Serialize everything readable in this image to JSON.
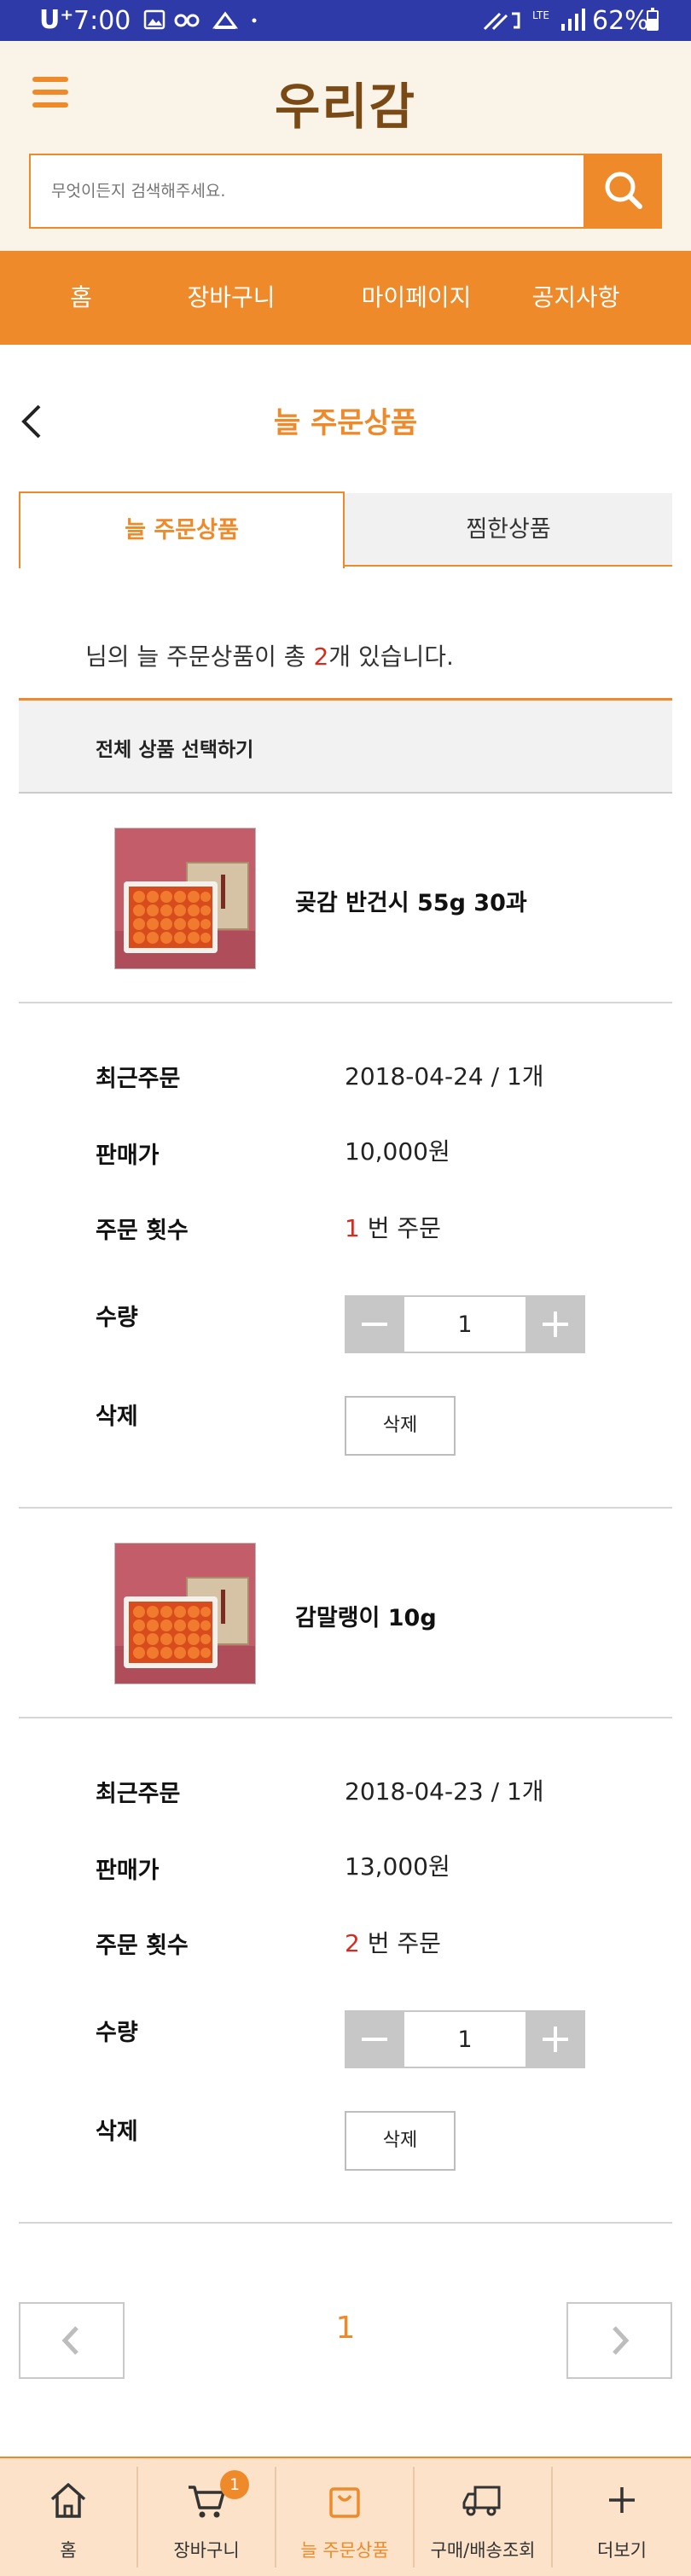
{
  "status_bar": {
    "carrier": "U⁺",
    "time": "7:00",
    "battery_percent": "62%",
    "network": "LTE",
    "battery_level": 0.62
  },
  "header": {
    "logo": "우리감",
    "search": {
      "placeholder": "무엇이든지 검색해주세요."
    }
  },
  "nav": [
    "홈",
    "장바구니",
    "마이페이지",
    "공지사항"
  ],
  "page": {
    "title": "늘 주문상품",
    "tabs": {
      "active": "늘 주문상품",
      "inactive": "찜한상품"
    },
    "summary": {
      "prefix": "님의 늘 주문상품이 총 ",
      "count": "2",
      "suffix": "개 있습니다."
    },
    "select_all": "전체 상품 선택하기",
    "labels": {
      "recent_order": "최근주문",
      "price": "판매가",
      "order_count": "주문 횟수",
      "quantity": "수량",
      "delete": "삭제"
    },
    "order_suffix": " 번 주문",
    "delete_button": "삭제"
  },
  "products": [
    {
      "name": "곶감 반건시 55g 30과",
      "recent_order": "2018-04-24 / 1개",
      "price": "10,000원",
      "order_count": "1",
      "quantity": "1"
    },
    {
      "name": "감말랭이 10g",
      "recent_order": "2018-04-23 / 1개",
      "price": "13,000원",
      "order_count": "2",
      "quantity": "1"
    }
  ],
  "pagination": {
    "current": "1"
  },
  "bottom_bar": {
    "items": [
      "홈",
      "장바구니",
      "늘 주문상품",
      "구매/배송조회",
      "더보기"
    ],
    "cart_badge": "1"
  },
  "icons": {
    "menu": "hamburger-menu-icon",
    "search": "search-icon",
    "back": "chevron-left-icon",
    "prev": "chevron-left-icon",
    "next": "chevron-right-icon",
    "home": "home-icon",
    "cart": "cart-icon",
    "bag": "shopping-bag-icon",
    "truck": "delivery-truck-icon",
    "plus": "plus-icon"
  },
  "colors": {
    "accent": "#ee8a2a",
    "header_bg": "#faf3e7",
    "status_bar": "#2f3aa9",
    "highlight": "#d62b1f",
    "bottom_bar": "#fbe2c8"
  }
}
